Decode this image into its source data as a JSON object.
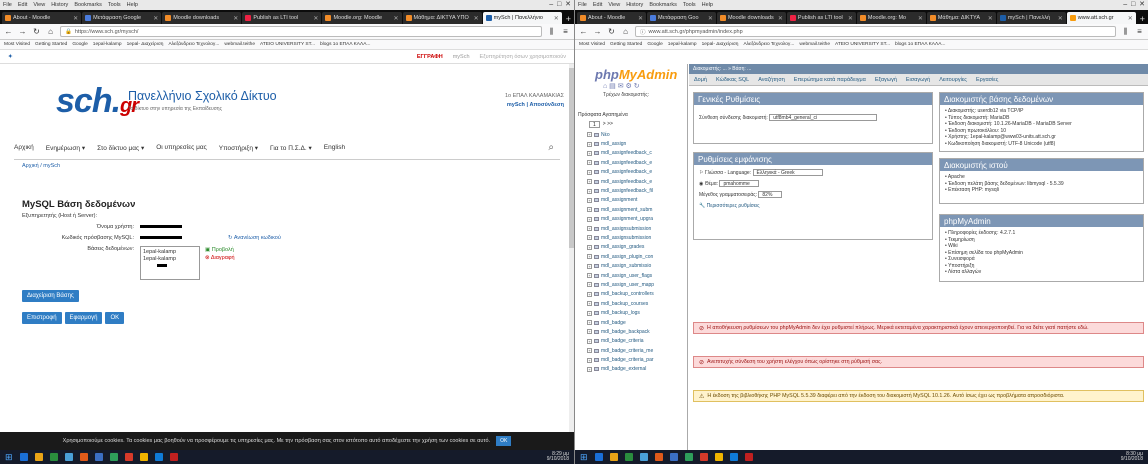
{
  "left": {
    "menu": [
      "File",
      "Edit",
      "View",
      "History",
      "Bookmarks",
      "Tools",
      "Help"
    ],
    "tabs": [
      {
        "label": "About - Moodle",
        "color": "#f28c28"
      },
      {
        "label": "Μετάφραση Google",
        "color": "#4a7bdc"
      },
      {
        "label": "Moodle downloads",
        "color": "#f28c28"
      },
      {
        "label": "Publish as LTI tool",
        "color": "#e24"
      },
      {
        "label": "Moodle.org: Moodle",
        "color": "#f28c28"
      },
      {
        "label": "Μάθημα: ΔΙΚΤΥΑ ΥΠΟ",
        "color": "#f28c28"
      },
      {
        "label": "mySch | Πανελλήνιο",
        "color": "#1d5ea8"
      }
    ],
    "url": "https://www.sch.gr/mysch/",
    "bookmarks": [
      "Most Visited",
      "Getting Started",
      "Google",
      "1epal-kalamp",
      "1epal- Διαχείριση",
      "Αλεξάνδρειο Τεχνολογ...",
      "webmail.teithe",
      "ATEIO UNIVERSITY ST...",
      "blogs 1o ΕΠΑΛ ΚΑΛΑ..."
    ],
    "topbar": {
      "register": "ΕΓΓΡΑΦΗ",
      "mysch": "mySch",
      "search": "Εξυπηρέτηση όσων χρησιμοποιούν"
    },
    "logo": {
      "main": "sch.",
      "gr": "gr"
    },
    "site_name": "Πανελλήνιο Σχολικό Δίκτυο",
    "tagline": "Το δίκτυο στην υπηρεσία της Εκπαίδευσης",
    "school": {
      "name": "1o ΕΠΑΛ ΚΑΛΑΜΑΚΙΑΣ",
      "links": "mySch | Αποσύνδεση"
    },
    "nav": [
      "Αρχική",
      "Ενημέρωση ▾",
      "Στο δίκτυο μας ▾",
      "Οι υπηρεσίες μας",
      "Υποστήριξη ▾",
      "Για το Π.Σ.Δ. ▾",
      "English"
    ],
    "breadcrumb": "Αρχική / mySch",
    "section_title": "MySQL Βάση δεδομένων",
    "host_label": "Εξυπηρετητής (Host ή Server):",
    "username_label": "Όνομα χρήστη:",
    "password_label": "Κωδικός πρόσβασης MySQL:",
    "renew_label": "Ανανέωση κωδικού",
    "db_label": "Βάσεις δεδομένων:",
    "db_items": [
      "1epal-kalamp",
      "1epal-kalamp"
    ],
    "view_label": "Προβολή",
    "delete_label": "Διαγραφή",
    "manage_btn": "Διαχείριση Βάσης",
    "back_btn": "Επιστροφή",
    "apply_btn": "Εφαρμογή",
    "ok_btn": "OK",
    "cookie_text": "Χρησιμοποιούμε cookies. Τα cookies μας βοηθούν να προσφέρουμε τις υπηρεσίες μας. Με την πρόσβαση σας στον ιστότοπο αυτό αποδέχεστε την χρήση των cookies σε αυτό.",
    "cookie_ok": "ΟΚ",
    "clock": {
      "time": "8:29 μμ",
      "date": "9/10/2018"
    }
  },
  "right": {
    "menu": [
      "File",
      "Edit",
      "View",
      "History",
      "Bookmarks",
      "Tools",
      "Help"
    ],
    "tabs": [
      {
        "label": "About - Moodle",
        "color": "#f28c28"
      },
      {
        "label": "Μετάφραση Goo",
        "color": "#4a7bdc"
      },
      {
        "label": "Moodle downloads",
        "color": "#f28c28"
      },
      {
        "label": "Publish as LTI tool",
        "color": "#e24"
      },
      {
        "label": "Moodle.org: Mo",
        "color": "#f28c28"
      },
      {
        "label": "Μάθημα: ΔΙΚΤΥΑ",
        "color": "#f28c28"
      },
      {
        "label": "mySch | Πανελλή",
        "color": "#1d5ea8"
      },
      {
        "label": "www.att.sch.gr",
        "color": "#f89c0e"
      }
    ],
    "url": "www.att.sch.gr/phpmyadmin/index.php",
    "bookmarks": [
      "Most Visited",
      "Getting Started",
      "Google",
      "1epal-kalamp",
      "1epal- Διαχείριση",
      "Αλεξάνδρειο Τεχνολογ...",
      "webmail.teithe",
      "ATEIO UNIVERSITY ST...",
      "blogs 1o ΕΠΑΛ ΚΑΛΑ..."
    ],
    "pma_logo": {
      "php": "php",
      "my": "MyAdmin"
    },
    "recent_label": "Τρέχων διακομιστής:",
    "tree_header": "Πρόσφατα   Αγαπημένα",
    "page_select": "1",
    "tree_items": [
      "Νέο",
      "mdl_assign",
      "mdl_assignfeedback_c",
      "mdl_assignfeedback_e",
      "mdl_assignfeedback_e",
      "mdl_assignfeedback_e",
      "mdl_assignfeedback_fil",
      "mdl_assignment",
      "mdl_assignment_subm",
      "mdl_assignment_upgra",
      "mdl_assignsubmission",
      "mdl_assignsubmission",
      "mdl_assign_grades",
      "mdl_assign_plugin_con",
      "mdl_assign_submissio",
      "mdl_assign_user_flags",
      "mdl_assign_user_mapp",
      "mdl_backup_controllers",
      "mdl_backup_courses",
      "mdl_backup_logs",
      "mdl_badge",
      "mdl_badge_backpack",
      "mdl_badge_criteria",
      "mdl_badge_criteria_me",
      "mdl_badge_criteria_par",
      "mdl_badge_external"
    ],
    "top_strip": "Διακομιστής: ... » Βάση: ...",
    "tabs_pma": [
      "Δομή",
      "Κώδικας SQL",
      "Αναζήτηση",
      "Επερώτημα κατά παράδειγμα",
      "Εξαγωγή",
      "Εισαγωγή",
      "Λειτουργίες",
      "Εργασίες"
    ],
    "general": {
      "title": "Γενικές Ρυθμίσεις",
      "collation_label": "Σύνθεση σύνδεσης διακομιστή:",
      "collation_value": "utf8mb4_general_ci"
    },
    "appearance": {
      "title": "Ρυθμίσεις εμφάνισης",
      "lang_label": "Γλώσσα - Language:",
      "lang_value": "Ελληνικά - Greek",
      "theme_label": "Θέμα:",
      "theme_value": "pmahomme",
      "font_label": "Μέγεθος γραμματοσειράς:",
      "font_value": "82%",
      "more": "Περισσότερες ρυθμίσεις"
    },
    "dbserver": {
      "title": "Διακομιστής βάσης δεδομένων",
      "items": [
        "Διακομιστής: userdb12 via TCP/IP",
        "Τύπος διακομιστή: MariaDB",
        "Έκδοση διακομιστή: 10.1.26-MariaDB - MariaDB Server",
        "Έκδοση πρωτοκόλλου: 10",
        "Χρήστης: 1epal-kalamp@www03-units.att.sch.gr",
        "Κωδικοποίηση διακομιστή: UTF-8 Unicode (utf8)"
      ]
    },
    "webserver": {
      "title": "Διακομιστής ιστού",
      "items": [
        "Apache",
        "Έκδοση πελάτη βάσης δεδομένων: libmysql - 5.5.39",
        "Επέκταση PHP: mysqli"
      ]
    },
    "phpmyadmin": {
      "title": "phpMyAdmin",
      "items": [
        "Πληροφορίες έκδοσης: 4.2.7.1",
        "Τεκμηρίωση",
        "Wiki",
        "Επίσημη σελίδα του phpMyAdmin",
        "Συνεισφορά",
        "Υποστήριξη",
        "Λίστα αλλαγών"
      ]
    },
    "msg1": "Η αποθήκευση ρυθμίσεων του phpMyAdmin δεν έχει ρυθμιστεί πλήρως. Μερικά εκτεταμένα χαρακτηριστικά έχουν απενεργοποιηθεί. Για να δείτε γιατί πατήστε εδώ.",
    "msg2": "Ανεπιτυχής σύνδεση του χρήστη ελέγχου όπως ορίστηκε στη ρύθμισή σας.",
    "msg3": "Η έκδοση της βιβλιοθήκης PHP MySQL 5.5.39 διαφέρει από την έκδοση του διακομιστή MySQL 10.1.26. Αυτό ίσως έχει ως προβλήματα απροσδιόριστα.",
    "clock": {
      "time": "8:30 μμ",
      "date": "9/10/2018"
    }
  },
  "taskbar_icons": [
    "#1a6fd8",
    "#e8a317",
    "#2a8d3e",
    "#4aa0d8",
    "#e05a1a",
    "#3b6fc4",
    "#2e9e5b",
    "#d63a2a",
    "#f0b400",
    "#0f7bd8",
    "#c02020"
  ]
}
